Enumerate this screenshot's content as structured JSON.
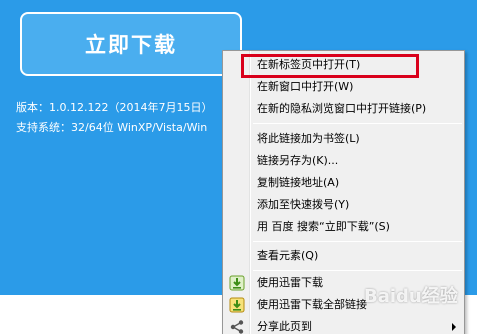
{
  "page": {
    "download_button": "立即下载",
    "version_text": "版本：1.0.12.122（2014年7月15日）",
    "system_text": "支持系统：32/64位 WinXP/Vista/Win"
  },
  "context_menu": {
    "items": [
      {
        "label": "在新标签页中打开(T)"
      },
      {
        "label": "在新窗口中打开(W)"
      },
      {
        "label": "在新的隐私浏览窗口中打开链接(P)"
      },
      {
        "label": "将此链接加为书签(L)"
      },
      {
        "label": "链接另存为(K)..."
      },
      {
        "label": "复制链接地址(A)"
      },
      {
        "label": "添加至快速拨号(Y)"
      },
      {
        "label": "用 百度 搜索“立即下载”(S)"
      },
      {
        "label": "查看元素(Q)"
      },
      {
        "label": "使用迅雷下载"
      },
      {
        "label": "使用迅雷下载全部链接"
      },
      {
        "label": "分享此页到"
      }
    ]
  },
  "watermark": "Baidu经验",
  "colors": {
    "background_blue": "#2b9be8",
    "highlight_red": "#d9001b",
    "menu_bg": "#f0f0f0"
  }
}
